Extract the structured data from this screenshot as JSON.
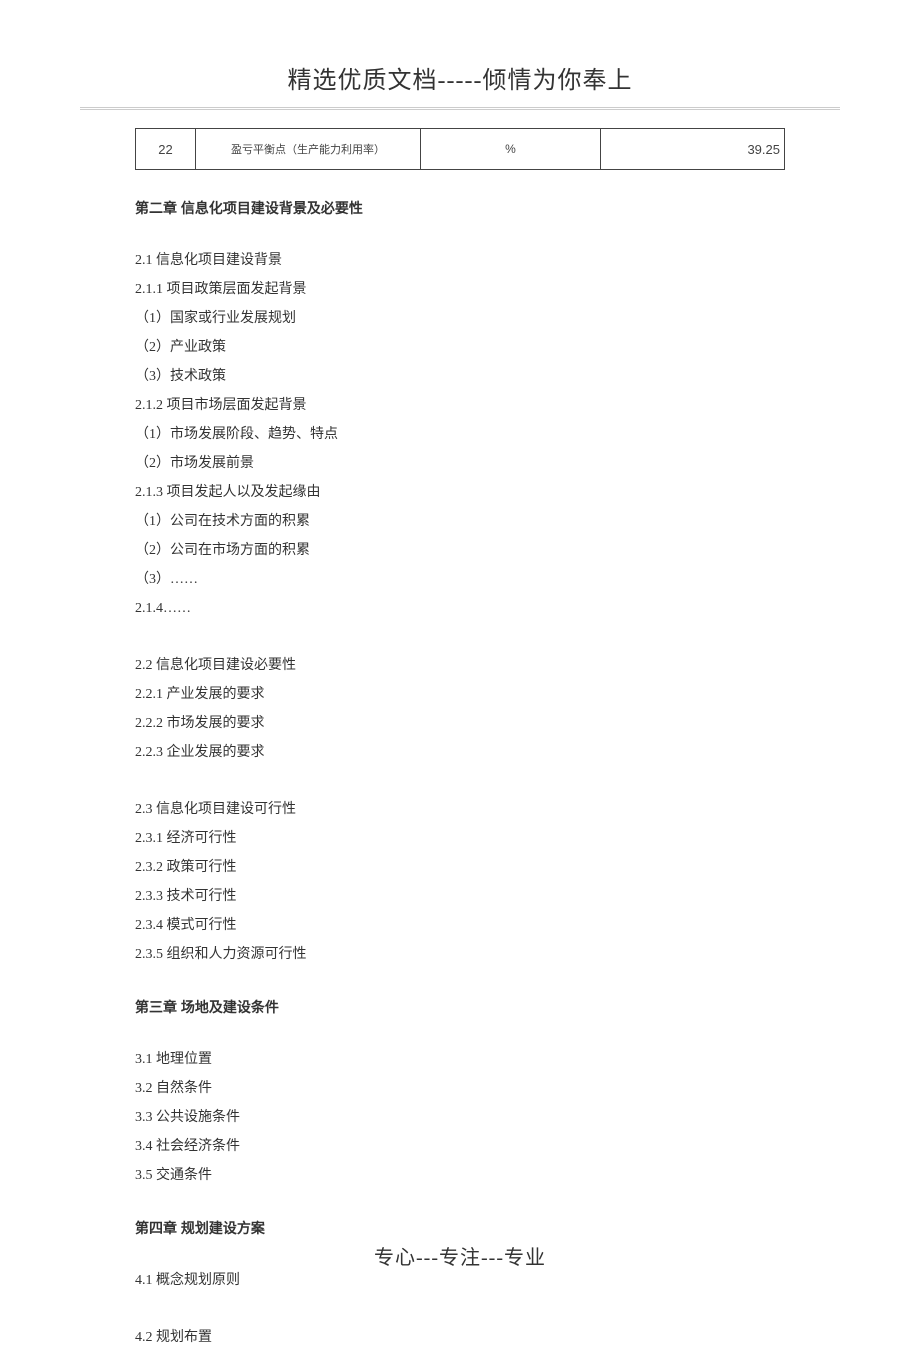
{
  "header": {
    "title": "精选优质文档-----倾情为你奉上"
  },
  "table": {
    "row": {
      "num": "22",
      "desc": "盈亏平衡点（生产能力利用率）",
      "unit": "%",
      "value": "39.25"
    }
  },
  "chapters": {
    "ch2": {
      "title": "第二章  信息化项目建设背景及必要性",
      "s1": {
        "h": "2.1  信息化项目建设背景",
        "l1": "2.1.1 项目政策层面发起背景",
        "l2": "（1）国家或行业发展规划",
        "l3": "（2）产业政策",
        "l4": "（3）技术政策",
        "l5": "2.1.2 项目市场层面发起背景",
        "l6": "（1）市场发展阶段、趋势、特点",
        "l7": "（2）市场发展前景",
        "l8": "2.1.3  项目发起人以及发起缘由",
        "l9": "（1）公司在技术方面的积累",
        "l10": "（2）公司在市场方面的积累",
        "l11": "（3）……",
        "l12": "2.1.4……"
      },
      "s2": {
        "h": "2.2  信息化项目建设必要性",
        "l1": "2.2.1 产业发展的要求",
        "l2": "2.2.2 市场发展的要求",
        "l3": "2.2.3 企业发展的要求"
      },
      "s3": {
        "h": "2.3  信息化项目建设可行性",
        "l1": "2.3.1 经济可行性",
        "l2": "2.3.2 政策可行性",
        "l3": "2.3.3 技术可行性",
        "l4": "2.3.4 模式可行性",
        "l5": "2.3.5 组织和人力资源可行性"
      }
    },
    "ch3": {
      "title": "第三章  场地及建设条件",
      "l1": "3.1  地理位置",
      "l2": "3.2  自然条件",
      "l3": "3.3  公共设施条件",
      "l4": "3.4  社会经济条件",
      "l5": "3.5  交通条件"
    },
    "ch4": {
      "title": "第四章  规划建设方案",
      "l1": "4.1  概念规划原则",
      "l2": "4.2  规划布置"
    }
  },
  "footer": {
    "text": "专心---专注---专业"
  }
}
